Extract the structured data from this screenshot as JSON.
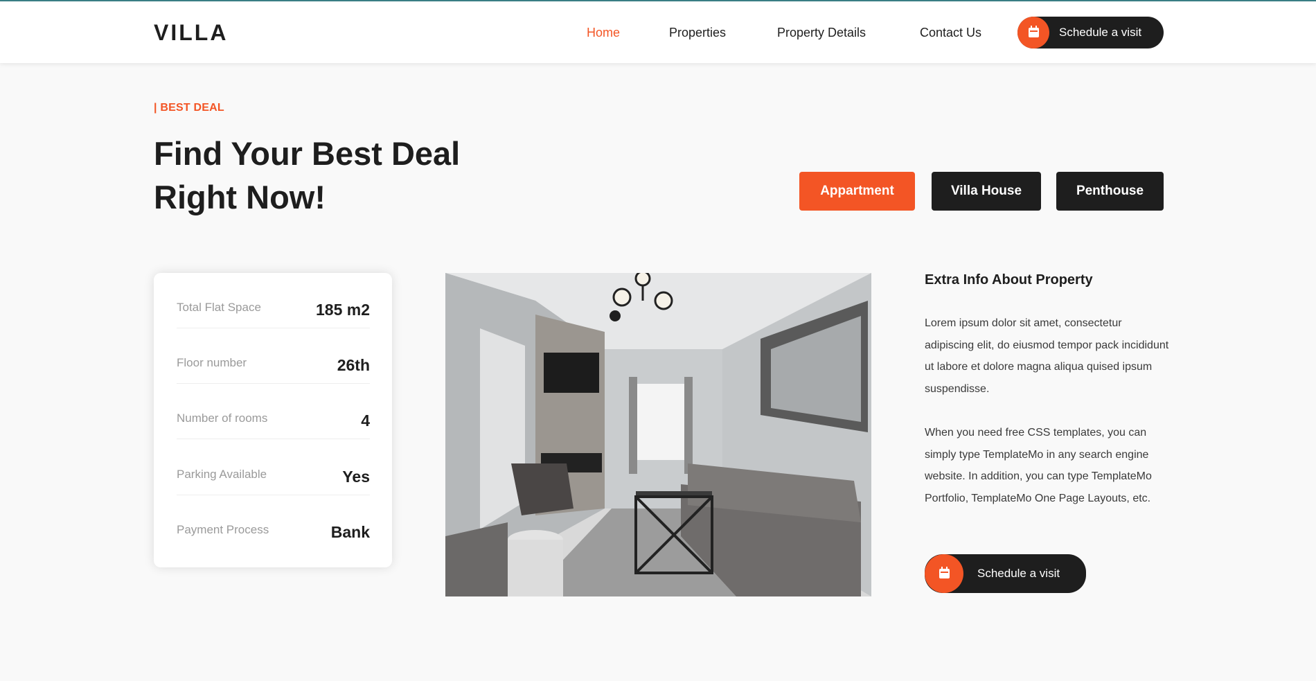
{
  "header": {
    "logo": "VILLA",
    "nav": [
      {
        "label": "Home",
        "active": true
      },
      {
        "label": "Properties",
        "active": false
      },
      {
        "label": "Property Details",
        "active": false
      },
      {
        "label": "Contact Us",
        "active": false
      }
    ],
    "cta_label": "Schedule a visit",
    "cta_icon": "calendar-icon"
  },
  "section": {
    "eyebrow": "| BEST DEAL",
    "title_line1": "Find Your Best Deal",
    "title_line2": "Right Now!",
    "tabs": [
      {
        "label": "Appartment",
        "active": true
      },
      {
        "label": "Villa House",
        "active": false
      },
      {
        "label": "Penthouse",
        "active": false
      }
    ]
  },
  "details": [
    {
      "label": "Total Flat Space",
      "value": "185 m2"
    },
    {
      "label": "Floor number",
      "value": "26th"
    },
    {
      "label": "Number of rooms",
      "value": "4"
    },
    {
      "label": "Parking Available",
      "value": "Yes"
    },
    {
      "label": "Payment Process",
      "value": "Bank"
    }
  ],
  "extra": {
    "title": "Extra Info About Property",
    "paragraph1": "Lorem ipsum dolor sit amet, consectetur adipiscing elit, do eiusmod tempor pack incididunt ut labore et dolore magna aliqua quised ipsum suspendisse.",
    "paragraph2": "When you need free CSS templates, you can simply type TemplateMo in any search engine website. In addition, you can type TemplateMo Portfolio, TemplateMo One Page Layouts, etc.",
    "cta_label": "Schedule a visit"
  },
  "colors": {
    "accent": "#f35525",
    "dark": "#1e1e1e",
    "background": "#f9f9f9"
  }
}
